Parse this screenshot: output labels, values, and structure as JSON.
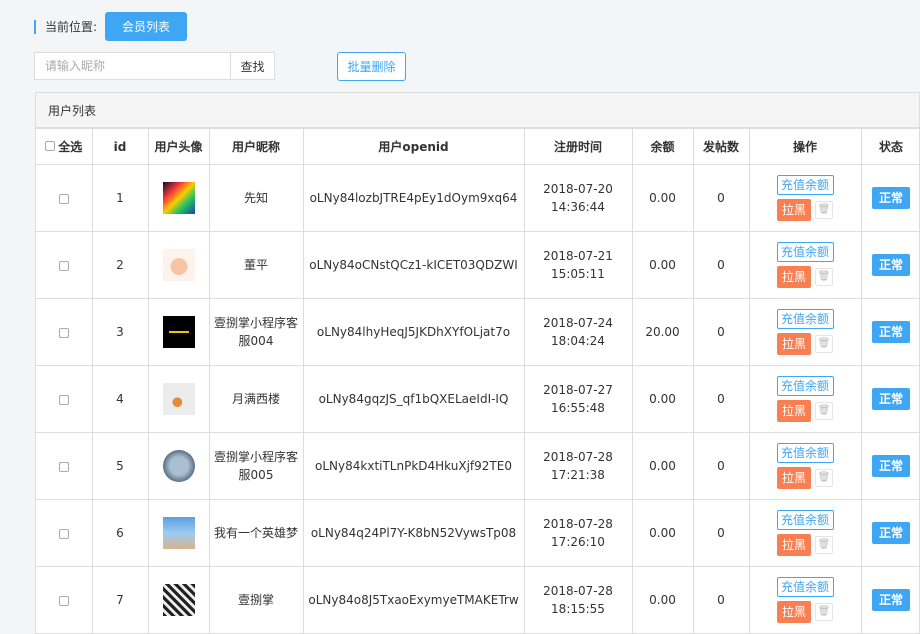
{
  "breadcrumb": {
    "label": "当前位置:",
    "current": "会员列表"
  },
  "search": {
    "placeholder": "请输入昵称",
    "value": "",
    "button": "查找"
  },
  "batch_delete": "批量删除",
  "panel_title": "用户列表",
  "columns": {
    "select_all": "全选",
    "id": "id",
    "avatar": "用户头像",
    "nickname": "用户昵称",
    "openid": "用户openid",
    "reg_time": "注册时间",
    "balance": "余额",
    "posts": "发帖数",
    "actions": "操作",
    "status": "状态"
  },
  "actions": {
    "recharge": "充值余额",
    "blacklist": "拉黑",
    "delete_icon": "trash-icon"
  },
  "rows": [
    {
      "id": "1",
      "avatar": "av1",
      "nickname": "先知",
      "openid": "oLNy84lozbJTRE4pEy1dOym9xq64",
      "date": "2018-07-20",
      "time": "14:36:44",
      "balance": "0.00",
      "posts": "0",
      "status": "正常"
    },
    {
      "id": "2",
      "avatar": "av2",
      "nickname": "董平",
      "openid": "oLNy84oCNstQCz1-kICET03QDZWI",
      "date": "2018-07-21",
      "time": "15:05:11",
      "balance": "0.00",
      "posts": "0",
      "status": "正常"
    },
    {
      "id": "3",
      "avatar": "av3",
      "nickname": "壹捌掌小程序客服004",
      "openid": "oLNy84lhyHeqJ5JKDhXYfOLjat7o",
      "date": "2018-07-24",
      "time": "18:04:24",
      "balance": "20.00",
      "posts": "0",
      "status": "正常"
    },
    {
      "id": "4",
      "avatar": "av4",
      "nickname": "月满西楼",
      "openid": "oLNy84gqzJS_qf1bQXELaeIdI-IQ",
      "date": "2018-07-27",
      "time": "16:55:48",
      "balance": "0.00",
      "posts": "0",
      "status": "正常"
    },
    {
      "id": "5",
      "avatar": "av5",
      "nickname": "壹捌掌小程序客服005",
      "openid": "oLNy84kxtiTLnPkD4HkuXjf92TE0",
      "date": "2018-07-28",
      "time": "17:21:38",
      "balance": "0.00",
      "posts": "0",
      "status": "正常"
    },
    {
      "id": "6",
      "avatar": "av6",
      "nickname": "我有一个英雄梦",
      "openid": "oLNy84q24Pl7Y-K8bN52VywsTp08",
      "date": "2018-07-28",
      "time": "17:26:10",
      "balance": "0.00",
      "posts": "0",
      "status": "正常"
    },
    {
      "id": "7",
      "avatar": "av7",
      "nickname": "壹捌掌",
      "openid": "oLNy84o8J5TxaoExymyeTMAKETrw",
      "date": "2018-07-28",
      "time": "18:15:55",
      "balance": "0.00",
      "posts": "0",
      "status": "正常"
    }
  ]
}
